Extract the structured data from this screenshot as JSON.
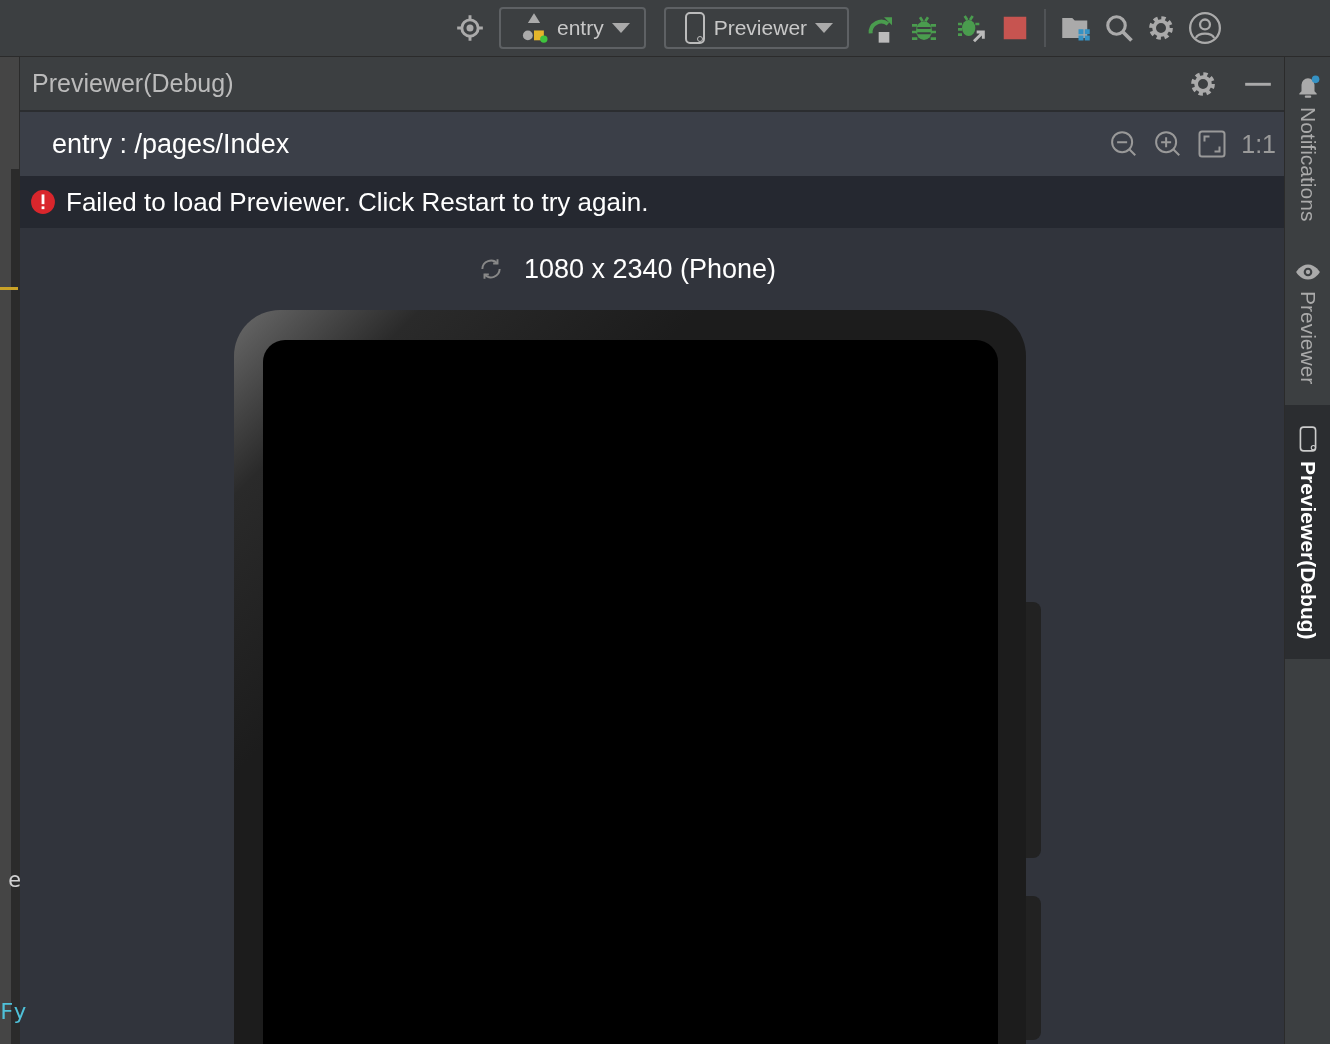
{
  "toolbar": {
    "run_config": {
      "label": "entry"
    },
    "device": {
      "label": "Previewer"
    }
  },
  "panel": {
    "title": "Previewer(Debug)",
    "path": "entry : /pages/Index",
    "zoom_label": "1:1",
    "error": "Failed to load Previewer. Click Restart to try again.",
    "device_label": "1080 x 2340 (Phone)"
  },
  "side_tabs": [
    {
      "label": "Notifications",
      "kind": "notifications",
      "selected": false
    },
    {
      "label": "Previewer",
      "kind": "previewer",
      "selected": false
    },
    {
      "label": "Previewer(Debug)",
      "kind": "device",
      "selected": true
    }
  ],
  "editor": {
    "fragments": [
      "e",
      "Fy"
    ]
  }
}
